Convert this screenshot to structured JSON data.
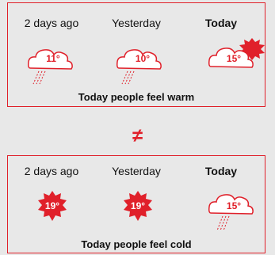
{
  "top_panel": {
    "days": [
      "2 days ago",
      "Yesterday",
      "Today"
    ],
    "temps": [
      "11°",
      "10°",
      "15°"
    ],
    "caption": "Today people feel warm"
  },
  "neq_symbol": "≠",
  "bottom_panel": {
    "days": [
      "2 days ago",
      "Yesterday",
      "Today"
    ],
    "temps": [
      "19°",
      "19°",
      "15°"
    ],
    "caption": "Today people feel cold"
  },
  "colors": {
    "accent": "#e0202a",
    "background": "#e8e8e8",
    "text": "#111111"
  },
  "icons": {
    "top": [
      "rain-cloud-icon",
      "rain-cloud-icon",
      "sun-behind-cloud-icon"
    ],
    "bottom": [
      "sun-icon",
      "sun-icon",
      "rain-cloud-icon"
    ]
  }
}
